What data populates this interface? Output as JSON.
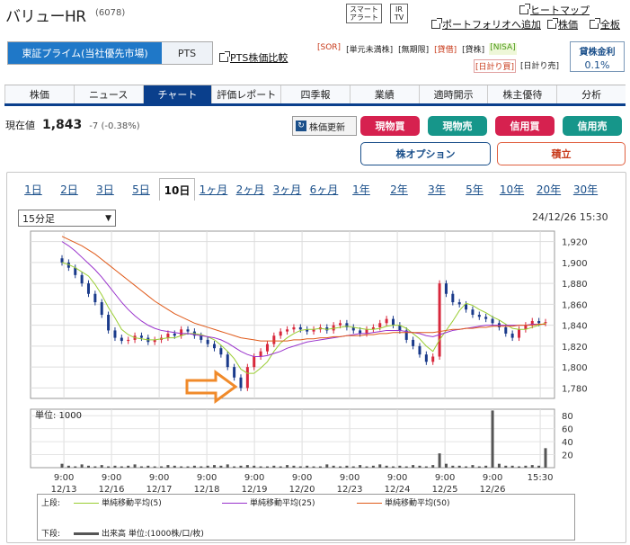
{
  "header": {
    "name": "バリューHR",
    "code": "(6078)",
    "smart_alert": "スマート\nアラート",
    "ir_tv": "IR\nTV",
    "heatmap": "ヒートマップ",
    "portfolio": "ポートフォリオへ追加",
    "stock_price": "株価",
    "all_boards": "全板"
  },
  "market": {
    "active": "東証プライム(当社優先市場)",
    "inactive": "PTS",
    "pts_compare": "PTS株価比較"
  },
  "badges": {
    "row1": [
      "[SOR]",
      "[単元未満株]",
      "[無期限]",
      "[貸借]",
      "[貸株]",
      "[NISA]"
    ],
    "row2": [
      "[日計り買]",
      "[日計り売]"
    ]
  },
  "lending_rate": {
    "label": "貸株金利",
    "value": "0.1%"
  },
  "tabs": [
    "株価",
    "ニュース",
    "チャート",
    "評価レポート",
    "四季報",
    "業績",
    "適時開示",
    "株主優待",
    "分析"
  ],
  "price": {
    "label": "現在値",
    "value": "1,843",
    "change": "-7 (-0.38%)"
  },
  "actions": {
    "refresh": "株価更新",
    "spot_buy": "現物買",
    "spot_sell": "現物売",
    "margin_buy": "信用買",
    "margin_sell": "信用売",
    "option": "株オプション",
    "tsumitate": "積立"
  },
  "periods": [
    "1日",
    "2日",
    "3日",
    "5日",
    "10日",
    "1ヶ月",
    "2ヶ月",
    "3ヶ月",
    "6ヶ月",
    "1年",
    "2年",
    "3年",
    "5年",
    "10年",
    "20年",
    "30年"
  ],
  "active_period": "10日",
  "interval": "15分足",
  "timestamp": "24/12/26 15:30",
  "colors": {
    "up": "#d8283c",
    "down": "#1a3a8a",
    "ma5": "#9acd32",
    "ma25": "#9932cc",
    "ma50": "#e05a1a",
    "arrow": "#f08a2a",
    "volume": "#555555"
  },
  "chart_data": {
    "type": "candlestick",
    "x_ticks": [
      {
        "time": "9:00",
        "date": "12/13"
      },
      {
        "time": "9:00",
        "date": "12/16"
      },
      {
        "time": "9:00",
        "date": "12/17"
      },
      {
        "time": "9:00",
        "date": "12/18"
      },
      {
        "time": "9:00",
        "date": "12/19"
      },
      {
        "time": "9:00",
        "date": "12/20"
      },
      {
        "time": "9:00",
        "date": "12/23"
      },
      {
        "time": "9:00",
        "date": "12/24"
      },
      {
        "time": "9:00",
        "date": "12/25"
      },
      {
        "time": "9:00",
        "date": "12/26"
      },
      {
        "time": "15:30",
        "date": ""
      }
    ],
    "y_ticks": [
      "1,920",
      "1,900",
      "1,880",
      "1,860",
      "1,840",
      "1,820",
      "1,800",
      "1,780"
    ],
    "ylim": [
      1770,
      1930
    ],
    "close": [
      1900,
      1895,
      1888,
      1880,
      1870,
      1862,
      1850,
      1835,
      1828,
      1825,
      1826,
      1830,
      1828,
      1824,
      1826,
      1828,
      1832,
      1830,
      1836,
      1834,
      1830,
      1826,
      1822,
      1818,
      1812,
      1800,
      1790,
      1780,
      1800,
      1810,
      1815,
      1822,
      1830,
      1834,
      1836,
      1838,
      1836,
      1834,
      1836,
      1838,
      1835,
      1840,
      1842,
      1838,
      1835,
      1832,
      1836,
      1838,
      1842,
      1846,
      1840,
      1835,
      1826,
      1820,
      1812,
      1805,
      1810,
      1880,
      1870,
      1862,
      1860,
      1855,
      1850,
      1848,
      1846,
      1842,
      1838,
      1832,
      1828,
      1836,
      1840,
      1844,
      1842,
      1843
    ],
    "ma5": [
      1900,
      1898,
      1895,
      1891,
      1887,
      1879,
      1869,
      1857,
      1847,
      1836,
      1831,
      1828,
      1827,
      1826,
      1826,
      1827,
      1828,
      1828,
      1830,
      1832,
      1832,
      1831,
      1829,
      1826,
      1821,
      1815,
      1808,
      1798,
      1794,
      1794,
      1799,
      1805,
      1815,
      1823,
      1828,
      1832,
      1835,
      1836,
      1836,
      1837,
      1836,
      1837,
      1838,
      1839,
      1838,
      1837,
      1836,
      1836,
      1837,
      1839,
      1840,
      1840,
      1837,
      1832,
      1827,
      1820,
      1815,
      1826,
      1835,
      1844,
      1854,
      1861,
      1859,
      1855,
      1852,
      1848,
      1845,
      1841,
      1837,
      1836,
      1836,
      1838,
      1840,
      1842
    ],
    "ma25": [
      1920,
      1916,
      1911,
      1905,
      1899,
      1893,
      1886,
      1878,
      1870,
      1862,
      1855,
      1849,
      1844,
      1840,
      1837,
      1835,
      1834,
      1833,
      1832,
      1832,
      1831,
      1830,
      1829,
      1828,
      1826,
      1823,
      1819,
      1815,
      1812,
      1810,
      1810,
      1811,
      1813,
      1815,
      1818,
      1820,
      1822,
      1824,
      1825,
      1826,
      1827,
      1828,
      1829,
      1830,
      1831,
      1832,
      1832,
      1833,
      1834,
      1835,
      1835,
      1835,
      1834,
      1833,
      1832,
      1830,
      1829,
      1831,
      1833,
      1835,
      1836,
      1837,
      1838,
      1839,
      1840,
      1840,
      1840,
      1840,
      1840,
      1840,
      1840,
      1841,
      1841,
      1841
    ],
    "ma50": [
      1925,
      1922,
      1919,
      1916,
      1912,
      1908,
      1903,
      1898,
      1893,
      1888,
      1883,
      1878,
      1873,
      1868,
      1863,
      1859,
      1855,
      1851,
      1848,
      1845,
      1842,
      1840,
      1838,
      1836,
      1834,
      1832,
      1830,
      1828,
      1827,
      1826,
      1825,
      1825,
      1825,
      1825,
      1825,
      1826,
      1826,
      1827,
      1827,
      1828,
      1828,
      1829,
      1829,
      1830,
      1830,
      1830,
      1831,
      1831,
      1832,
      1832,
      1833,
      1833,
      1833,
      1833,
      1833,
      1833,
      1833,
      1834,
      1835,
      1836,
      1836,
      1837,
      1837,
      1838,
      1838,
      1839,
      1839,
      1839,
      1839,
      1840,
      1840,
      1840,
      1841,
      1841
    ],
    "volume_axis_label": "単位: 1000",
    "volume_ticks": [
      "80",
      "60",
      "40",
      "20"
    ],
    "volume_ylim": [
      0,
      90
    ],
    "volume": [
      6,
      3,
      2,
      5,
      3,
      2,
      4,
      2,
      3,
      2,
      3,
      5,
      2,
      3,
      2,
      2,
      4,
      3,
      2,
      2,
      3,
      2,
      3,
      4,
      3,
      5,
      2,
      3,
      4,
      3,
      2,
      2,
      3,
      2,
      4,
      3,
      2,
      3,
      2,
      2,
      5,
      3,
      2,
      3,
      2,
      4,
      2,
      3,
      5,
      3,
      2,
      3,
      2,
      4,
      3,
      2,
      4,
      22,
      6,
      3,
      3,
      2,
      4,
      2,
      3,
      88,
      6,
      3,
      3,
      2,
      3,
      4,
      3,
      30
    ]
  },
  "legend": {
    "upper_label": "上段:",
    "ma5": "単純移動平均(5)",
    "ma25": "単純移動平均(25)",
    "ma50": "単純移動平均(50)",
    "lower_label": "下段:",
    "volume": "出来高 単位:(1000株/口/枚)"
  }
}
